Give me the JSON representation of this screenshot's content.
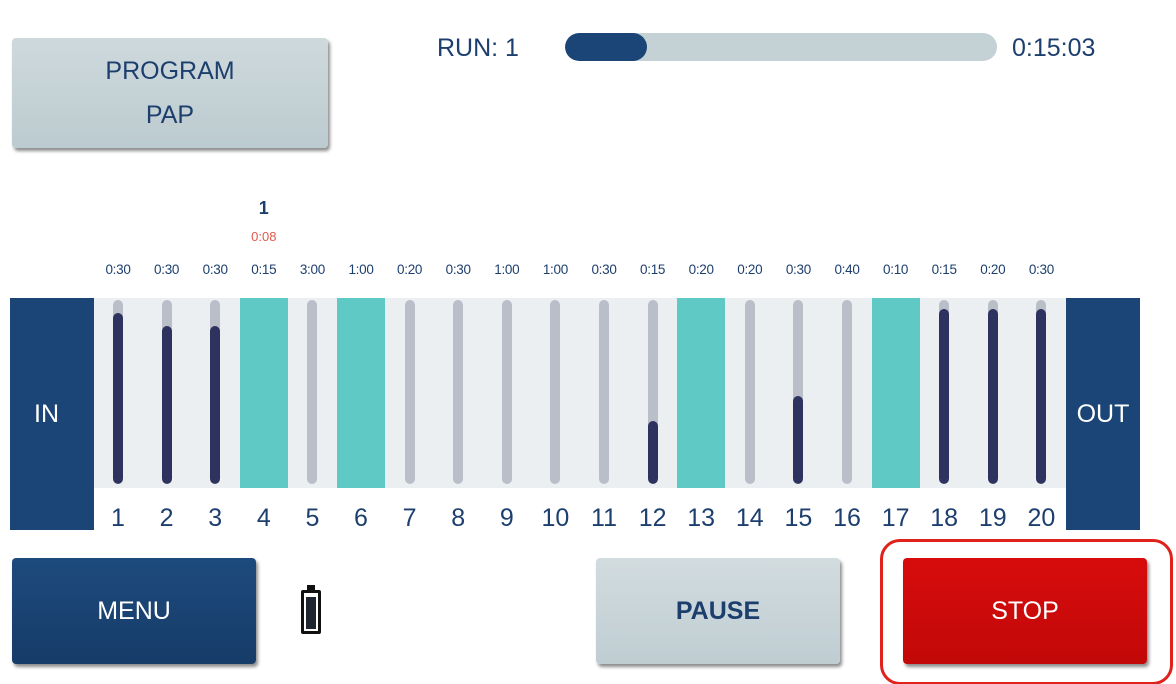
{
  "program": {
    "line1": "PROGRAM",
    "line2": "PAP"
  },
  "run": {
    "label": "RUN: 1",
    "progress": 0.19,
    "time": "0:15:03"
  },
  "current_station": {
    "run_number": "1",
    "remaining": "0:08"
  },
  "side_labels": {
    "in": "IN",
    "out": "OUT"
  },
  "stations": [
    {
      "label": "1",
      "duration": "0:30",
      "fill": 0.93,
      "active": false
    },
    {
      "label": "2",
      "duration": "0:30",
      "fill": 0.86,
      "active": false
    },
    {
      "label": "3",
      "duration": "0:30",
      "fill": 0.86,
      "active": false
    },
    {
      "label": "4",
      "duration": "0:15",
      "fill": 0,
      "active": true
    },
    {
      "label": "5",
      "duration": "3:00",
      "fill": 0,
      "active": false
    },
    {
      "label": "6",
      "duration": "1:00",
      "fill": 0,
      "active": true
    },
    {
      "label": "7",
      "duration": "0:20",
      "fill": 0,
      "active": false
    },
    {
      "label": "8",
      "duration": "0:30",
      "fill": 0,
      "active": false
    },
    {
      "label": "9",
      "duration": "1:00",
      "fill": 0,
      "active": false
    },
    {
      "label": "10",
      "duration": "1:00",
      "fill": 0,
      "active": false
    },
    {
      "label": "11",
      "duration": "0:30",
      "fill": 0,
      "active": false
    },
    {
      "label": "12",
      "duration": "0:15",
      "fill": 0.34,
      "active": false
    },
    {
      "label": "13",
      "duration": "0:20",
      "fill": 0,
      "active": true
    },
    {
      "label": "14",
      "duration": "0:20",
      "fill": 0,
      "active": false
    },
    {
      "label": "15",
      "duration": "0:30",
      "fill": 0.48,
      "active": false
    },
    {
      "label": "16",
      "duration": "0:40",
      "fill": 0,
      "active": false
    },
    {
      "label": "17",
      "duration": "0:10",
      "fill": 0,
      "active": true
    },
    {
      "label": "18",
      "duration": "0:15",
      "fill": 0.95,
      "active": false
    },
    {
      "label": "19",
      "duration": "0:20",
      "fill": 0.95,
      "active": false
    },
    {
      "label": "20",
      "duration": "0:30",
      "fill": 0.95,
      "active": false
    }
  ],
  "buttons": {
    "menu": "MENU",
    "pause": "PAUSE",
    "stop": "STOP"
  },
  "battery": {
    "level": 0.95
  },
  "colors": {
    "navy": "#1b4577",
    "teal": "#5fcac5",
    "tube": "#b9bec8",
    "tube_fill": "#2e325e",
    "stop": "#d70c0c",
    "remaining_text": "#e15a4c"
  }
}
